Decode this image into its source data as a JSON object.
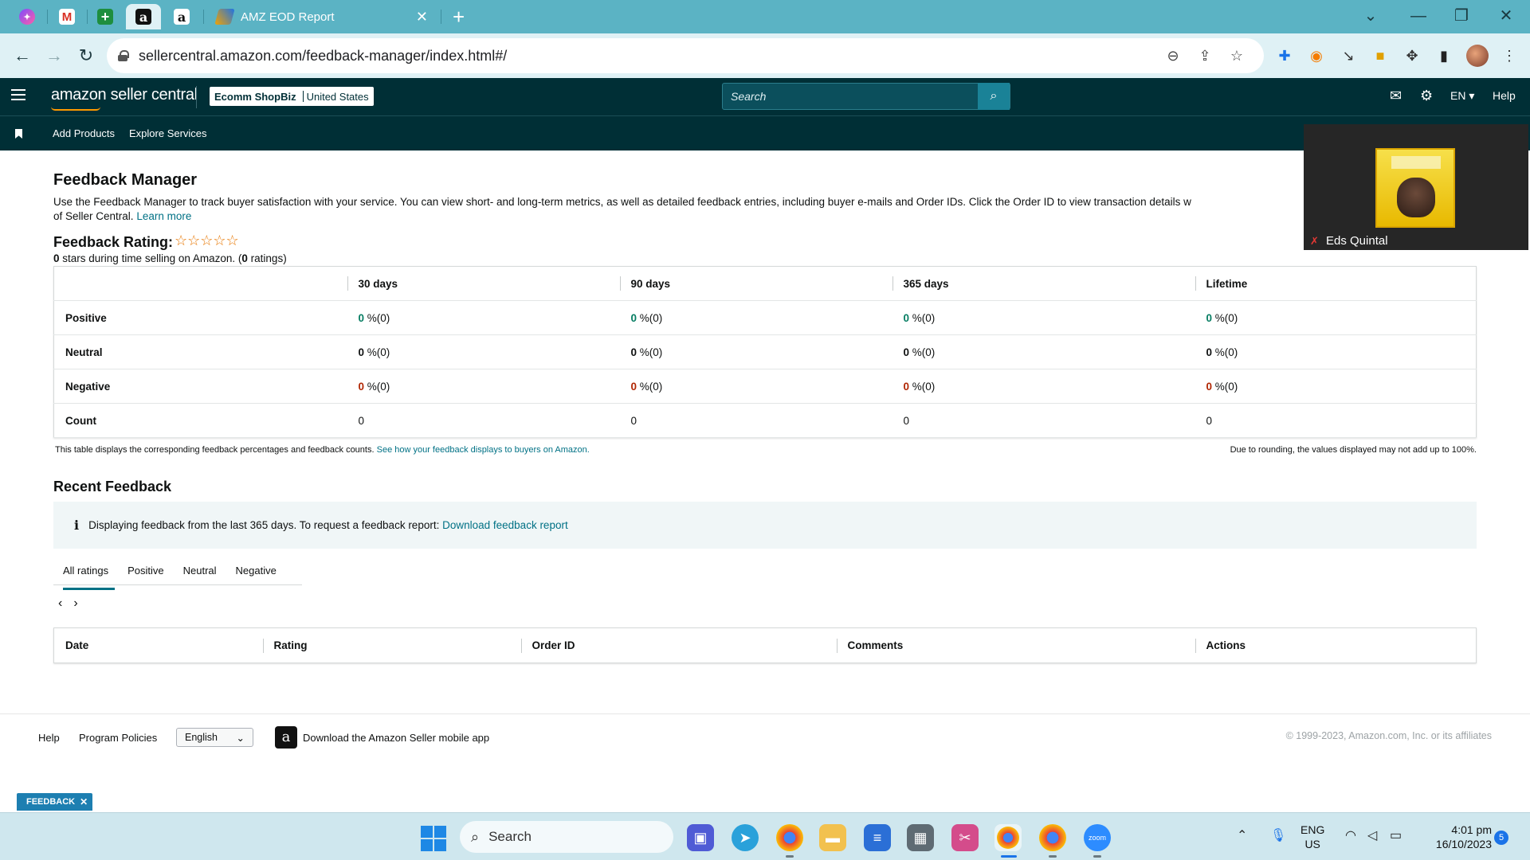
{
  "browser": {
    "tabs": [
      {
        "icon": "messenger-icon"
      },
      {
        "icon": "gmail-icon"
      },
      {
        "icon": "sheets-icon"
      },
      {
        "icon": "amazon-icon"
      },
      {
        "icon": "amazon-icon"
      },
      {
        "title": "AMZ EOD Report",
        "icon": "report-icon"
      }
    ],
    "url": "sellercentral.amazon.com/feedback-manager/index.html#/"
  },
  "header": {
    "logo_text": "amazon seller central",
    "store_name": "Ecomm ShopBiz",
    "store_region": "United States",
    "search_placeholder": "Search",
    "language": "EN",
    "help": "Help"
  },
  "subnav": {
    "items": [
      "Add Products",
      "Explore Services"
    ]
  },
  "page": {
    "title": "Feedback Manager",
    "description": "Use the Feedback Manager to track buyer satisfaction with your service. You can view short- and long-term metrics, as well as detailed feedback entries, including buyer e-mails and Order IDs. Click the Order ID to view transaction details w",
    "description_line2": "of Seller Central.",
    "learn_more": "Learn more",
    "rating_title": "Feedback Rating:",
    "stars": "☆☆☆☆☆",
    "rating_count": "0",
    "rating_sub_a": "stars during time selling on Amazon. (",
    "rating_sub_b": "0",
    "rating_sub_c": "ratings)"
  },
  "feedback_table": {
    "columns": [
      "30 days",
      "90 days",
      "365 days",
      "Lifetime"
    ],
    "rows": [
      {
        "label": "Positive",
        "values": [
          "0",
          "0",
          "0",
          "0"
        ],
        "suffix": "%(0)"
      },
      {
        "label": "Neutral",
        "values": [
          "0",
          "0",
          "0",
          "0"
        ],
        "suffix": "%(0)"
      },
      {
        "label": "Negative",
        "values": [
          "0",
          "0",
          "0",
          "0"
        ],
        "suffix": "%(0)"
      },
      {
        "label": "Count",
        "values": [
          "0",
          "0",
          "0",
          "0"
        ]
      }
    ],
    "note": "This table displays the corresponding feedback percentages and feedback counts.",
    "note_link": "See how your feedback displays to buyers on Amazon.",
    "note_right": "Due to rounding, the values displayed may not add up to 100%."
  },
  "recent": {
    "title": "Recent Feedback",
    "alert_text": "Displaying feedback from the last 365 days. To request a feedback report:",
    "alert_link": "Download feedback report",
    "tabs": [
      "All ratings",
      "Positive",
      "Neutral",
      "Negative"
    ],
    "active_tab": "All ratings",
    "columns": [
      "Date",
      "Rating",
      "Order ID",
      "Comments",
      "Actions"
    ]
  },
  "footer": {
    "help": "Help",
    "policies": "Program Policies",
    "language": "English",
    "app_text": "Download the Amazon Seller mobile app",
    "copyright": "© 1999-2023, Amazon.com, Inc. or its affiliates"
  },
  "badge": {
    "label": "FEEDBACK"
  },
  "video": {
    "participant": "Eds Quintal"
  },
  "taskbar": {
    "search": "Search",
    "lang_line1": "ENG",
    "lang_line2": "US",
    "time": "4:01 pm",
    "date": "16/10/2023",
    "notifications": "5"
  },
  "colors": {
    "header_bg": "#002f36",
    "link": "#007185",
    "positive": "#067d62",
    "negative": "#b12704",
    "browser_frame": "#5bb3c4"
  }
}
